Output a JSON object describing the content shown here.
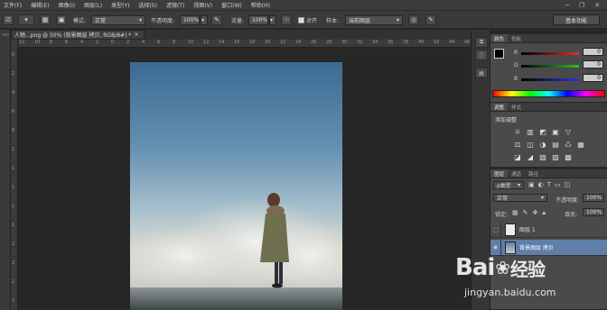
{
  "menu": {
    "items": [
      "文件(F)",
      "编辑(E)",
      "图像(I)",
      "图层(L)",
      "类型(Y)",
      "选择(S)",
      "滤镜(T)",
      "视图(V)",
      "窗口(W)",
      "帮助(H)"
    ],
    "window_controls": [
      "−",
      "❐",
      "✕"
    ]
  },
  "options": {
    "mode_label": "模式:",
    "mode_value": "正常",
    "opacity_label": "不透明度:",
    "opacity_value": "100%",
    "flow_label": "流量:",
    "flow_value": "100%",
    "align_label": "对齐",
    "sample_label": "样本:",
    "sample_value": "当前图层",
    "workspace_button": "基本功能"
  },
  "document": {
    "tab_label": "人物...png @ 50% (背景图层 拷贝, RGB/8#) *",
    "tab_close": "×"
  },
  "rulers": {
    "top": [
      "12",
      "10",
      "8",
      "6",
      "4",
      "2",
      "0",
      "2",
      "4",
      "6",
      "8",
      "10",
      "12",
      "14",
      "16",
      "18",
      "20",
      "22",
      "24",
      "26",
      "28",
      "30",
      "32",
      "34",
      "36",
      "38",
      "40",
      "42",
      "44",
      "46"
    ],
    "left": [
      "0",
      "2",
      "4",
      "6",
      "8",
      "1",
      "1",
      "1",
      "1",
      "1",
      "2",
      "2",
      "2",
      "2"
    ]
  },
  "color_panel": {
    "tabs": [
      "颜色",
      "色板"
    ],
    "channels": [
      {
        "label": "R",
        "value": "0",
        "color": "#d33"
      },
      {
        "label": "G",
        "value": "0",
        "color": "#3b3"
      },
      {
        "label": "B",
        "value": "0",
        "color": "#33d"
      }
    ]
  },
  "adjustments_panel": {
    "tabs": [
      "调整",
      "样式"
    ],
    "title": "添加调整",
    "row1_icons": [
      "☼",
      "▥",
      "◩",
      "▣",
      "▽"
    ],
    "row2_icons": [
      "⚖",
      "◫",
      "◑",
      "▤",
      "♺",
      "▦"
    ],
    "row3_icons": [
      "◪",
      "◢",
      "▧",
      "▨",
      "▩"
    ]
  },
  "layers_panel": {
    "tabs": [
      "图层",
      "通道",
      "路径"
    ],
    "kind_label": "ρ类型",
    "blend_value": "正常",
    "opacity_label": "不透明度:",
    "opacity_value": "100%",
    "lock_label": "锁定:",
    "fill_label": "填充:",
    "fill_value": "100%",
    "layers": [
      {
        "name": "图层 1",
        "visible": false,
        "selected": false
      },
      {
        "name": "背景图层 拷贝",
        "visible": true,
        "selected": true
      }
    ]
  },
  "watermark": {
    "brand": "Bai",
    "brand_tail": "经验",
    "url": "jingyan.baidu.com"
  }
}
